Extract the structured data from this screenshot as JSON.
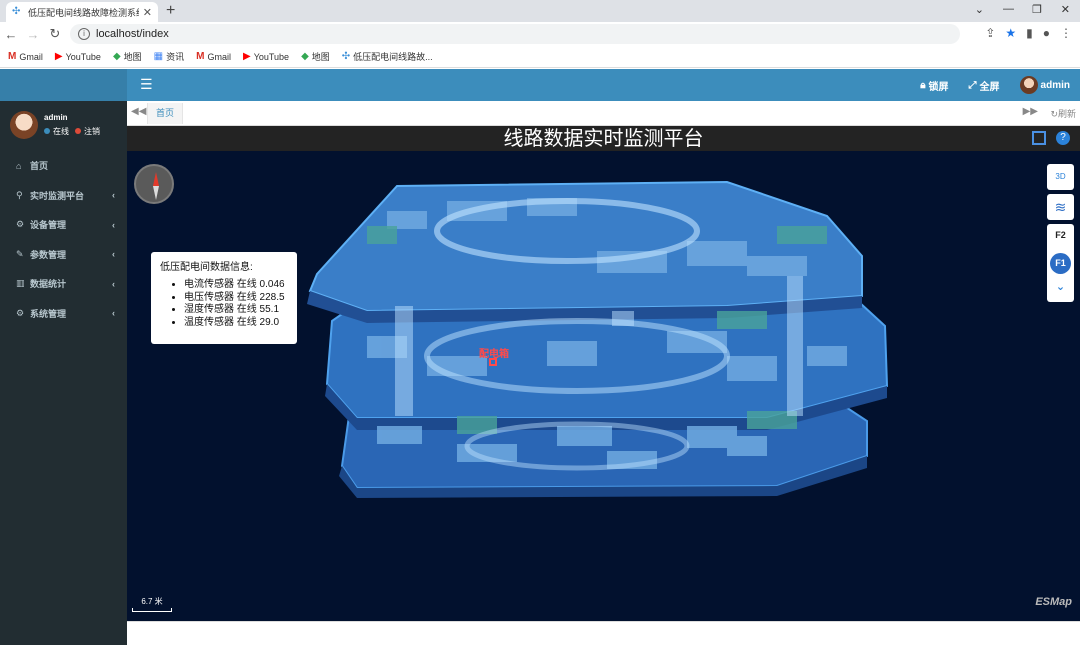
{
  "browser": {
    "tab_title": "低压配电间线路故障检测系统首页",
    "url": "localhost/index",
    "bookmarks": [
      "Gmail",
      "YouTube",
      "地图",
      "资讯",
      "Gmail",
      "YouTube",
      "地图",
      "低压配电间线路故..."
    ]
  },
  "header": {
    "lock_label": "锁屏",
    "fullscreen_label": "全屏",
    "user_label": "admin"
  },
  "sidebar": {
    "user": {
      "name": "admin",
      "online_label": "在线",
      "logout_label": "注销"
    },
    "items": [
      {
        "label": "首页",
        "icon": "home-icon",
        "expandable": false
      },
      {
        "label": "实时监测平台",
        "icon": "binoculars-icon",
        "expandable": true
      },
      {
        "label": "设备管理",
        "icon": "gears-icon",
        "expandable": true
      },
      {
        "label": "参数管理",
        "icon": "wrench-icon",
        "expandable": true
      },
      {
        "label": "数据统计",
        "icon": "bar-chart-icon",
        "expandable": true
      },
      {
        "label": "系统管理",
        "icon": "gear-icon",
        "expandable": true
      }
    ]
  },
  "tabs": {
    "home_label": "首页",
    "refresh_label": "刷新"
  },
  "map": {
    "title": "线路数据实时监测平台",
    "info_box": {
      "heading": "低压配电间数据信息:",
      "rows": [
        "电流传感器 在线 0.046",
        "电压传感器 在线 228.5",
        "湿度传感器 在线 55.1",
        "温度传感器 在线 29.0"
      ]
    },
    "marker_label": "配电箱",
    "control_3d_label": "3D",
    "floors": [
      "F2",
      "F1"
    ],
    "active_floor": "F1",
    "scale_label": "6.7 米",
    "brand_label": "ESMap"
  },
  "colors": {
    "header": "#3c8dbc",
    "sidebar": "#222d32",
    "map_bg": "#02112e",
    "floor": "#3a7ec8"
  }
}
